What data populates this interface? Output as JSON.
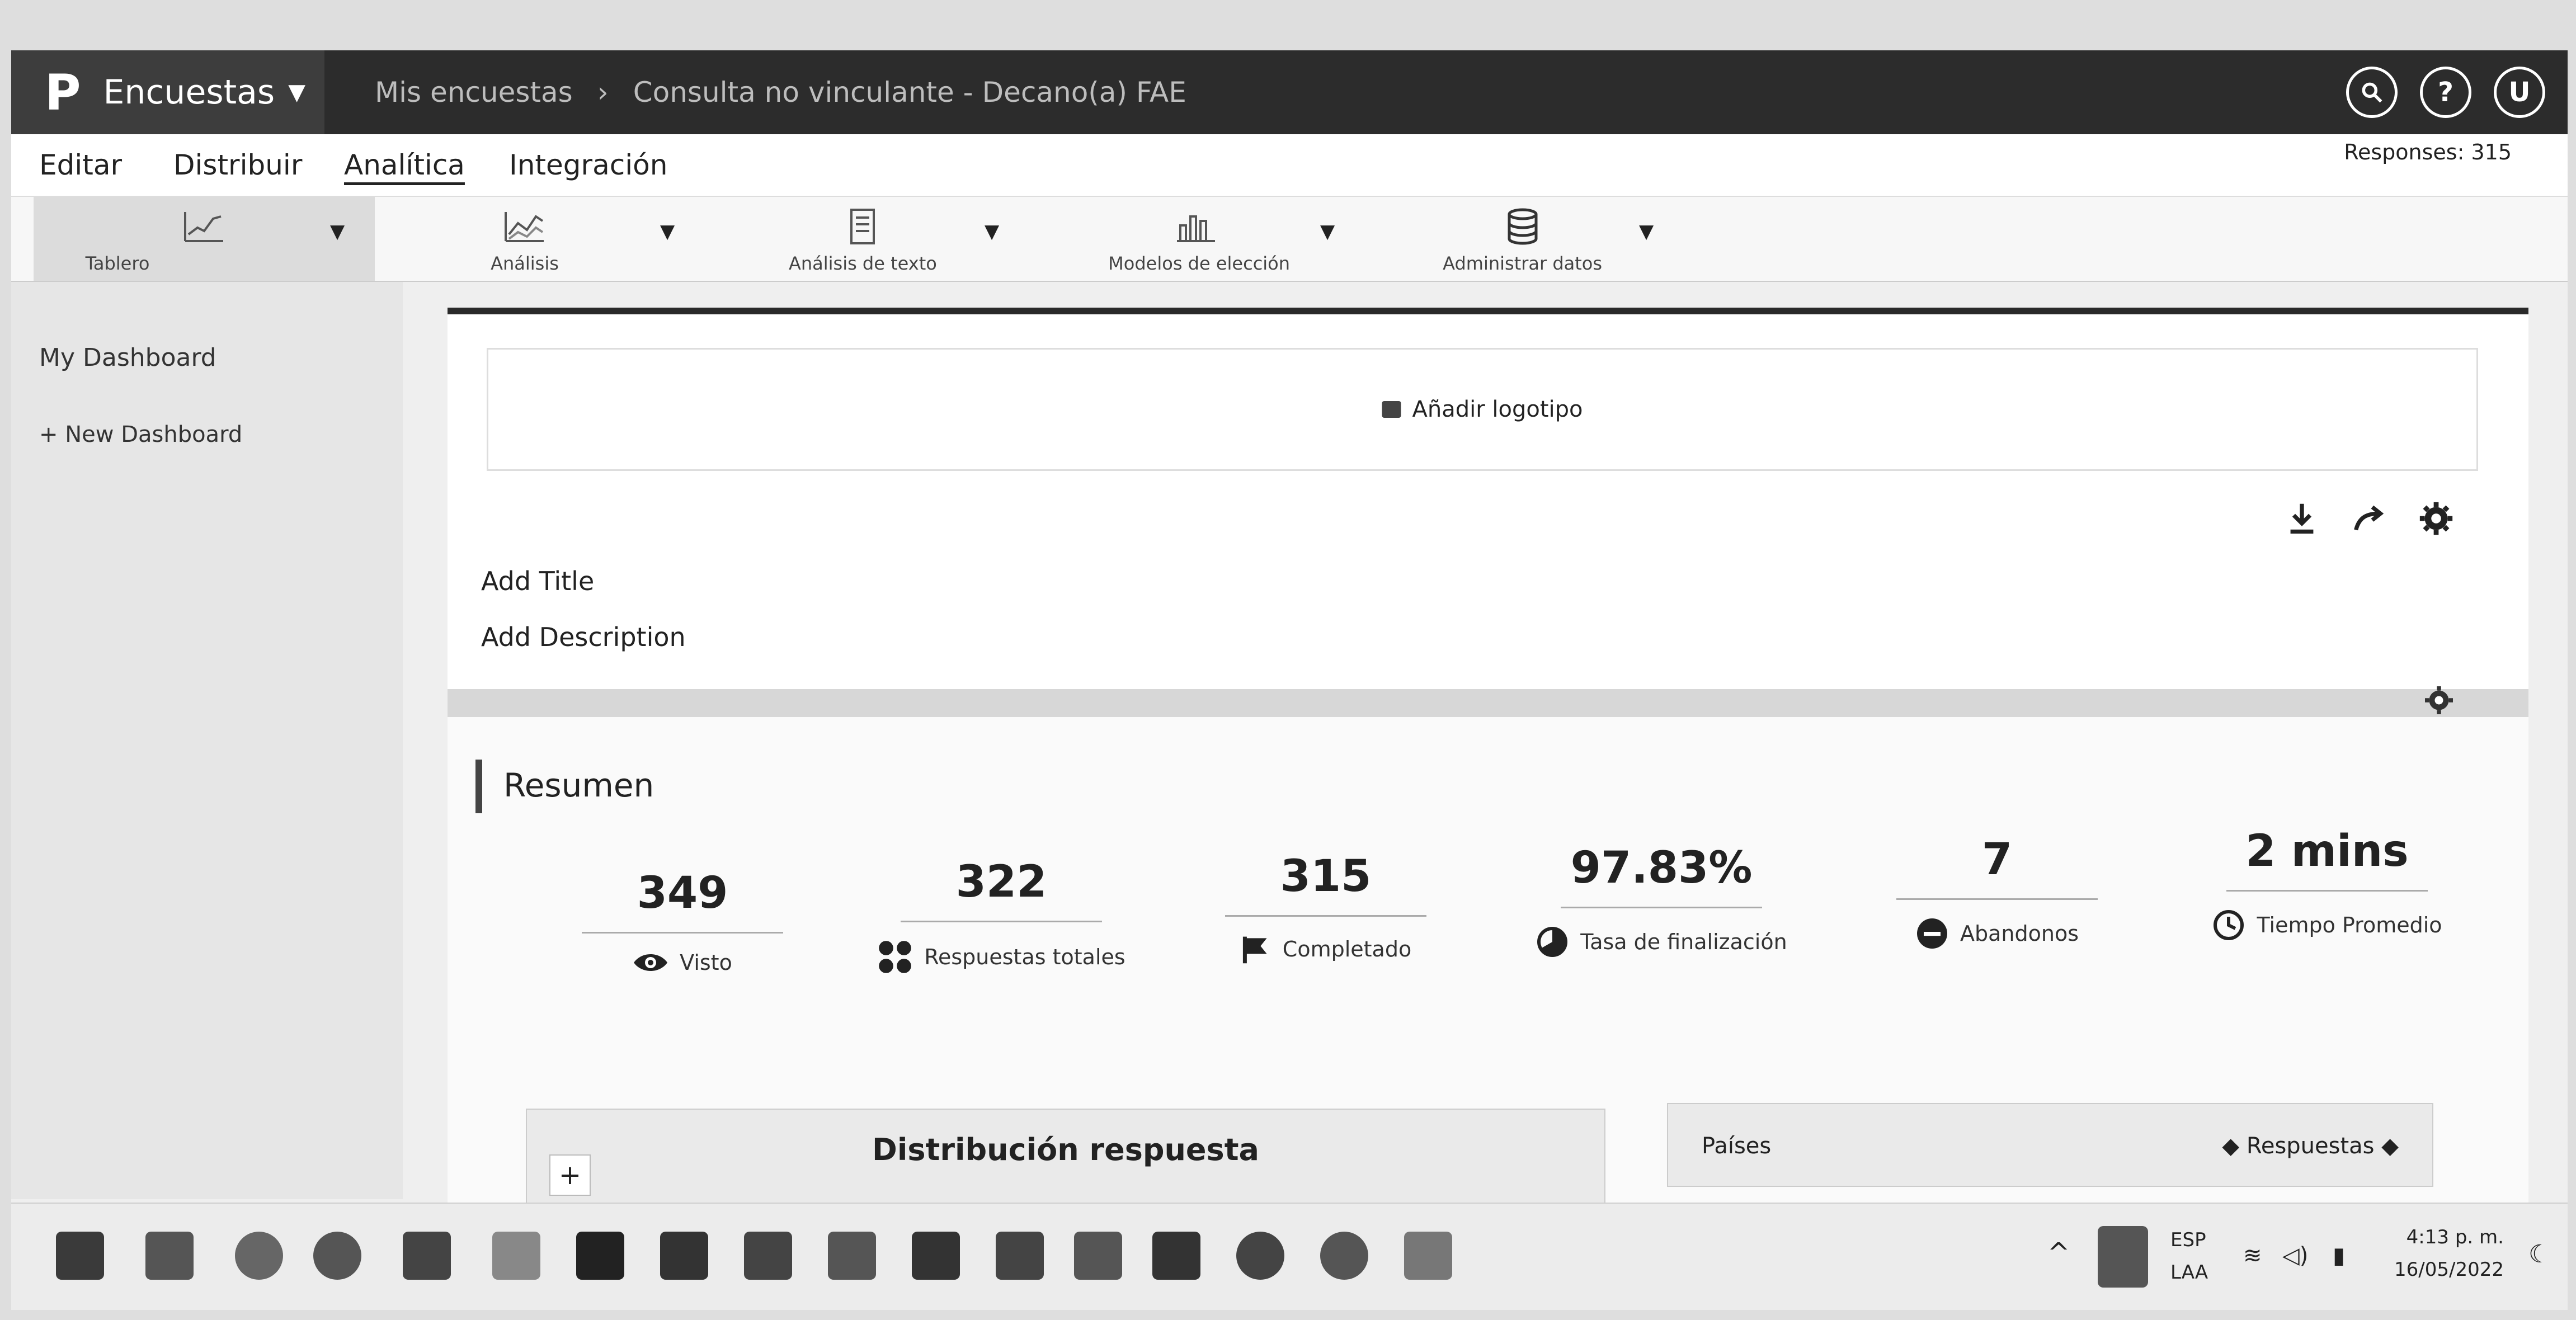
{
  "topbar": {
    "logo": "P",
    "app_name": "Encuestas",
    "crumbs": [
      "Mis encuestas",
      "Consulta no vinculante - Decano(a) FAE"
    ],
    "search_icon": "search-icon",
    "help_label": "?",
    "user_initial": "U"
  },
  "nav": {
    "items": [
      "Editar",
      "Distribuir",
      "Analítica",
      "Integración"
    ],
    "active": "Analítica",
    "responses": "Responses: 315"
  },
  "toolbar": {
    "items": [
      {
        "label": "Tablero",
        "icon": "chart-line-icon"
      },
      {
        "label": "Análisis",
        "icon": "chart-area-icon"
      },
      {
        "label": "Análisis de texto",
        "icon": "document-icon"
      },
      {
        "label": "Modelos de elección",
        "icon": "bar-chart-icon"
      },
      {
        "label": "Administrar datos",
        "icon": "database-icon"
      }
    ]
  },
  "sidebar": {
    "title": "My Dashboard",
    "new_dashboard": "New Dashboard"
  },
  "main": {
    "add_logo": "Añadir logotipo",
    "add_title": "Add Title",
    "add_description": "Add Description",
    "summary_title": "Resumen",
    "stats": [
      {
        "value": "349",
        "label": "Visto",
        "icon": "eye-icon"
      },
      {
        "value": "322",
        "label": "Respuestas totales",
        "icon": "grid-icon"
      },
      {
        "value": "315",
        "label": "Completado",
        "icon": "flag-icon"
      },
      {
        "value": "97.83%",
        "label": "Tasa de finalización",
        "icon": "pie-icon"
      },
      {
        "value": "7",
        "label": "Abandonos",
        "icon": "minus-circle-icon"
      },
      {
        "value": "2 mins",
        "label": "Tiempo Promedio",
        "icon": "clock-icon"
      }
    ],
    "distribution_title": "Distribución respuesta",
    "zoom_in": "+",
    "zoom_out": "−",
    "table_col1": "Países",
    "table_col2": "Respuestas"
  },
  "taskbar": {
    "lang": "ESP",
    "layout": "LAA",
    "time": "4:13 p. m.",
    "date": "16/05/2022"
  },
  "colors": {
    "topbar": "#2c2c2c",
    "brand": "#3d3d3d",
    "accent": "#222222"
  }
}
